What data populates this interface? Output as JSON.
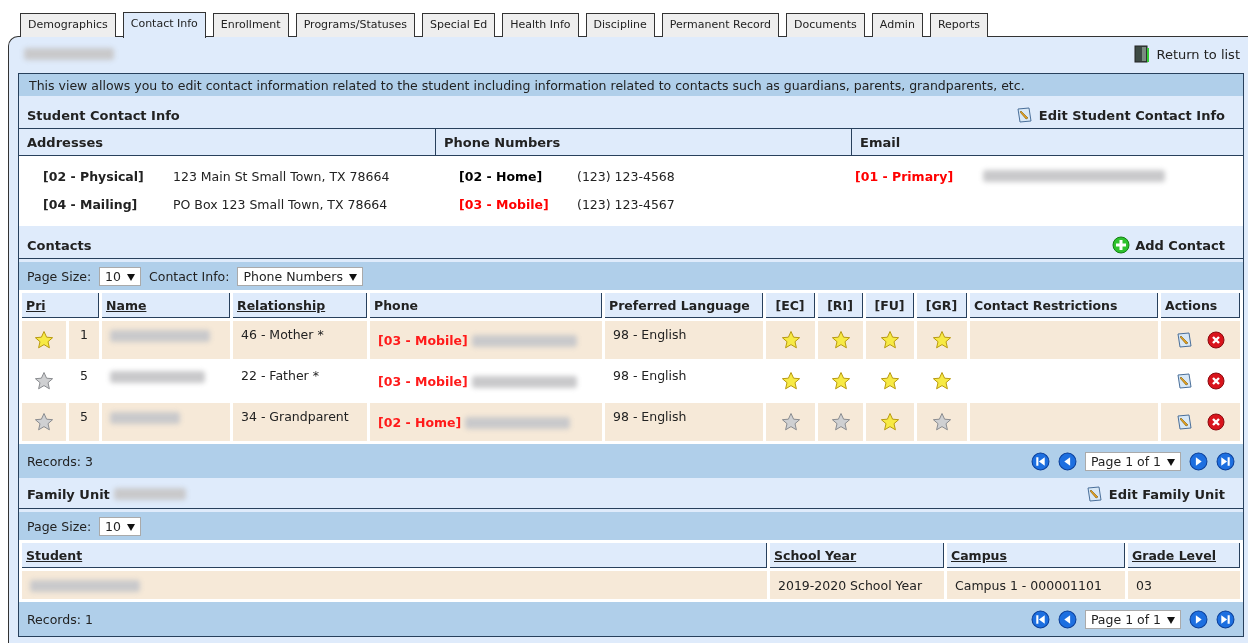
{
  "tabs": [
    {
      "label": "Demographics",
      "selected": false
    },
    {
      "label": "Contact Info",
      "selected": true
    },
    {
      "label": "Enrollment",
      "selected": false
    },
    {
      "label": "Programs/Statuses",
      "selected": false
    },
    {
      "label": "Special Ed",
      "selected": false
    },
    {
      "label": "Health Info",
      "selected": false
    },
    {
      "label": "Discipline",
      "selected": false
    },
    {
      "label": "Permanent Record",
      "selected": false
    },
    {
      "label": "Documents",
      "selected": false
    },
    {
      "label": "Admin",
      "selected": false
    },
    {
      "label": "Reports",
      "selected": false
    }
  ],
  "return_link": "Return to list",
  "description": "This view allows you to edit contact information related to the student including information related to contacts such as guardians, parents, grandparents, etc.",
  "student_contact_info": {
    "title": "Student Contact Info",
    "edit_link": "Edit Student Contact Info",
    "columns": [
      "Addresses",
      "Phone Numbers",
      "Email"
    ],
    "addresses": [
      {
        "type": "[02 - Physical]",
        "value": "123 Main St Small Town, TX 78664"
      },
      {
        "type": "[04 - Mailing]",
        "value": "PO Box 123 Small Town, TX 78664"
      }
    ],
    "phone_numbers": [
      {
        "type": "[02 - Home]",
        "color": "#000000",
        "value": "(123) 123-4568"
      },
      {
        "type": "[03 - Mobile]",
        "color": "#ff0000",
        "value": "(123) 123-4567"
      }
    ],
    "emails": [
      {
        "type": "[01 - Primary]",
        "color": "#ff0000"
      }
    ]
  },
  "contacts": {
    "title": "Contacts",
    "add_link": "Add Contact",
    "page_size_label": "Page Size:",
    "page_size": "10",
    "contact_info_label": "Contact Info:",
    "contact_info": "Phone Numbers",
    "columns": [
      {
        "label": "Pri",
        "sortable": true
      },
      {
        "label": "Name",
        "sortable": true
      },
      {
        "label": "Relationship",
        "sortable": true
      },
      {
        "label": "Phone",
        "sortable": false
      },
      {
        "label": "Preferred Language",
        "sortable": false
      },
      {
        "label": "[EC]",
        "sortable": false
      },
      {
        "label": "[RI]",
        "sortable": false
      },
      {
        "label": "[FU]",
        "sortable": false
      },
      {
        "label": "[GR]",
        "sortable": false
      },
      {
        "label": "Contact Restrictions",
        "sortable": false
      },
      {
        "label": "Actions",
        "sortable": false
      }
    ],
    "rows": [
      {
        "primary": true,
        "number": "1",
        "relationship": "46 - Mother *",
        "phone_type": "[03 - Mobile]",
        "language": "98 - English",
        "flags": [
          true,
          true,
          true,
          true
        ]
      },
      {
        "primary": false,
        "number": "5",
        "relationship": "22 - Father *",
        "phone_type": "[03 - Mobile]",
        "language": "98 - English",
        "flags": [
          true,
          true,
          true,
          true
        ]
      },
      {
        "primary": false,
        "number": "5",
        "relationship": "34 - Grandparent",
        "phone_type": "[02 - Home]",
        "language": "98 - English",
        "flags": [
          false,
          false,
          true,
          false
        ]
      }
    ],
    "records": "Records: 3",
    "page": "Page 1 of 1"
  },
  "family_unit": {
    "title": "Family Unit",
    "edit_link": "Edit Family Unit",
    "page_size_label": "Page Size:",
    "page_size": "10",
    "columns": [
      {
        "label": "Student",
        "sortable": true
      },
      {
        "label": "School Year",
        "sortable": true
      },
      {
        "label": "Campus",
        "sortable": true
      },
      {
        "label": "Grade Level",
        "sortable": true
      }
    ],
    "rows": [
      {
        "school_year": "2019-2020 School Year",
        "campus": "Campus 1 - 000001101",
        "grade_level": "03"
      }
    ],
    "records": "Records: 1",
    "page": "Page 1 of 1"
  }
}
